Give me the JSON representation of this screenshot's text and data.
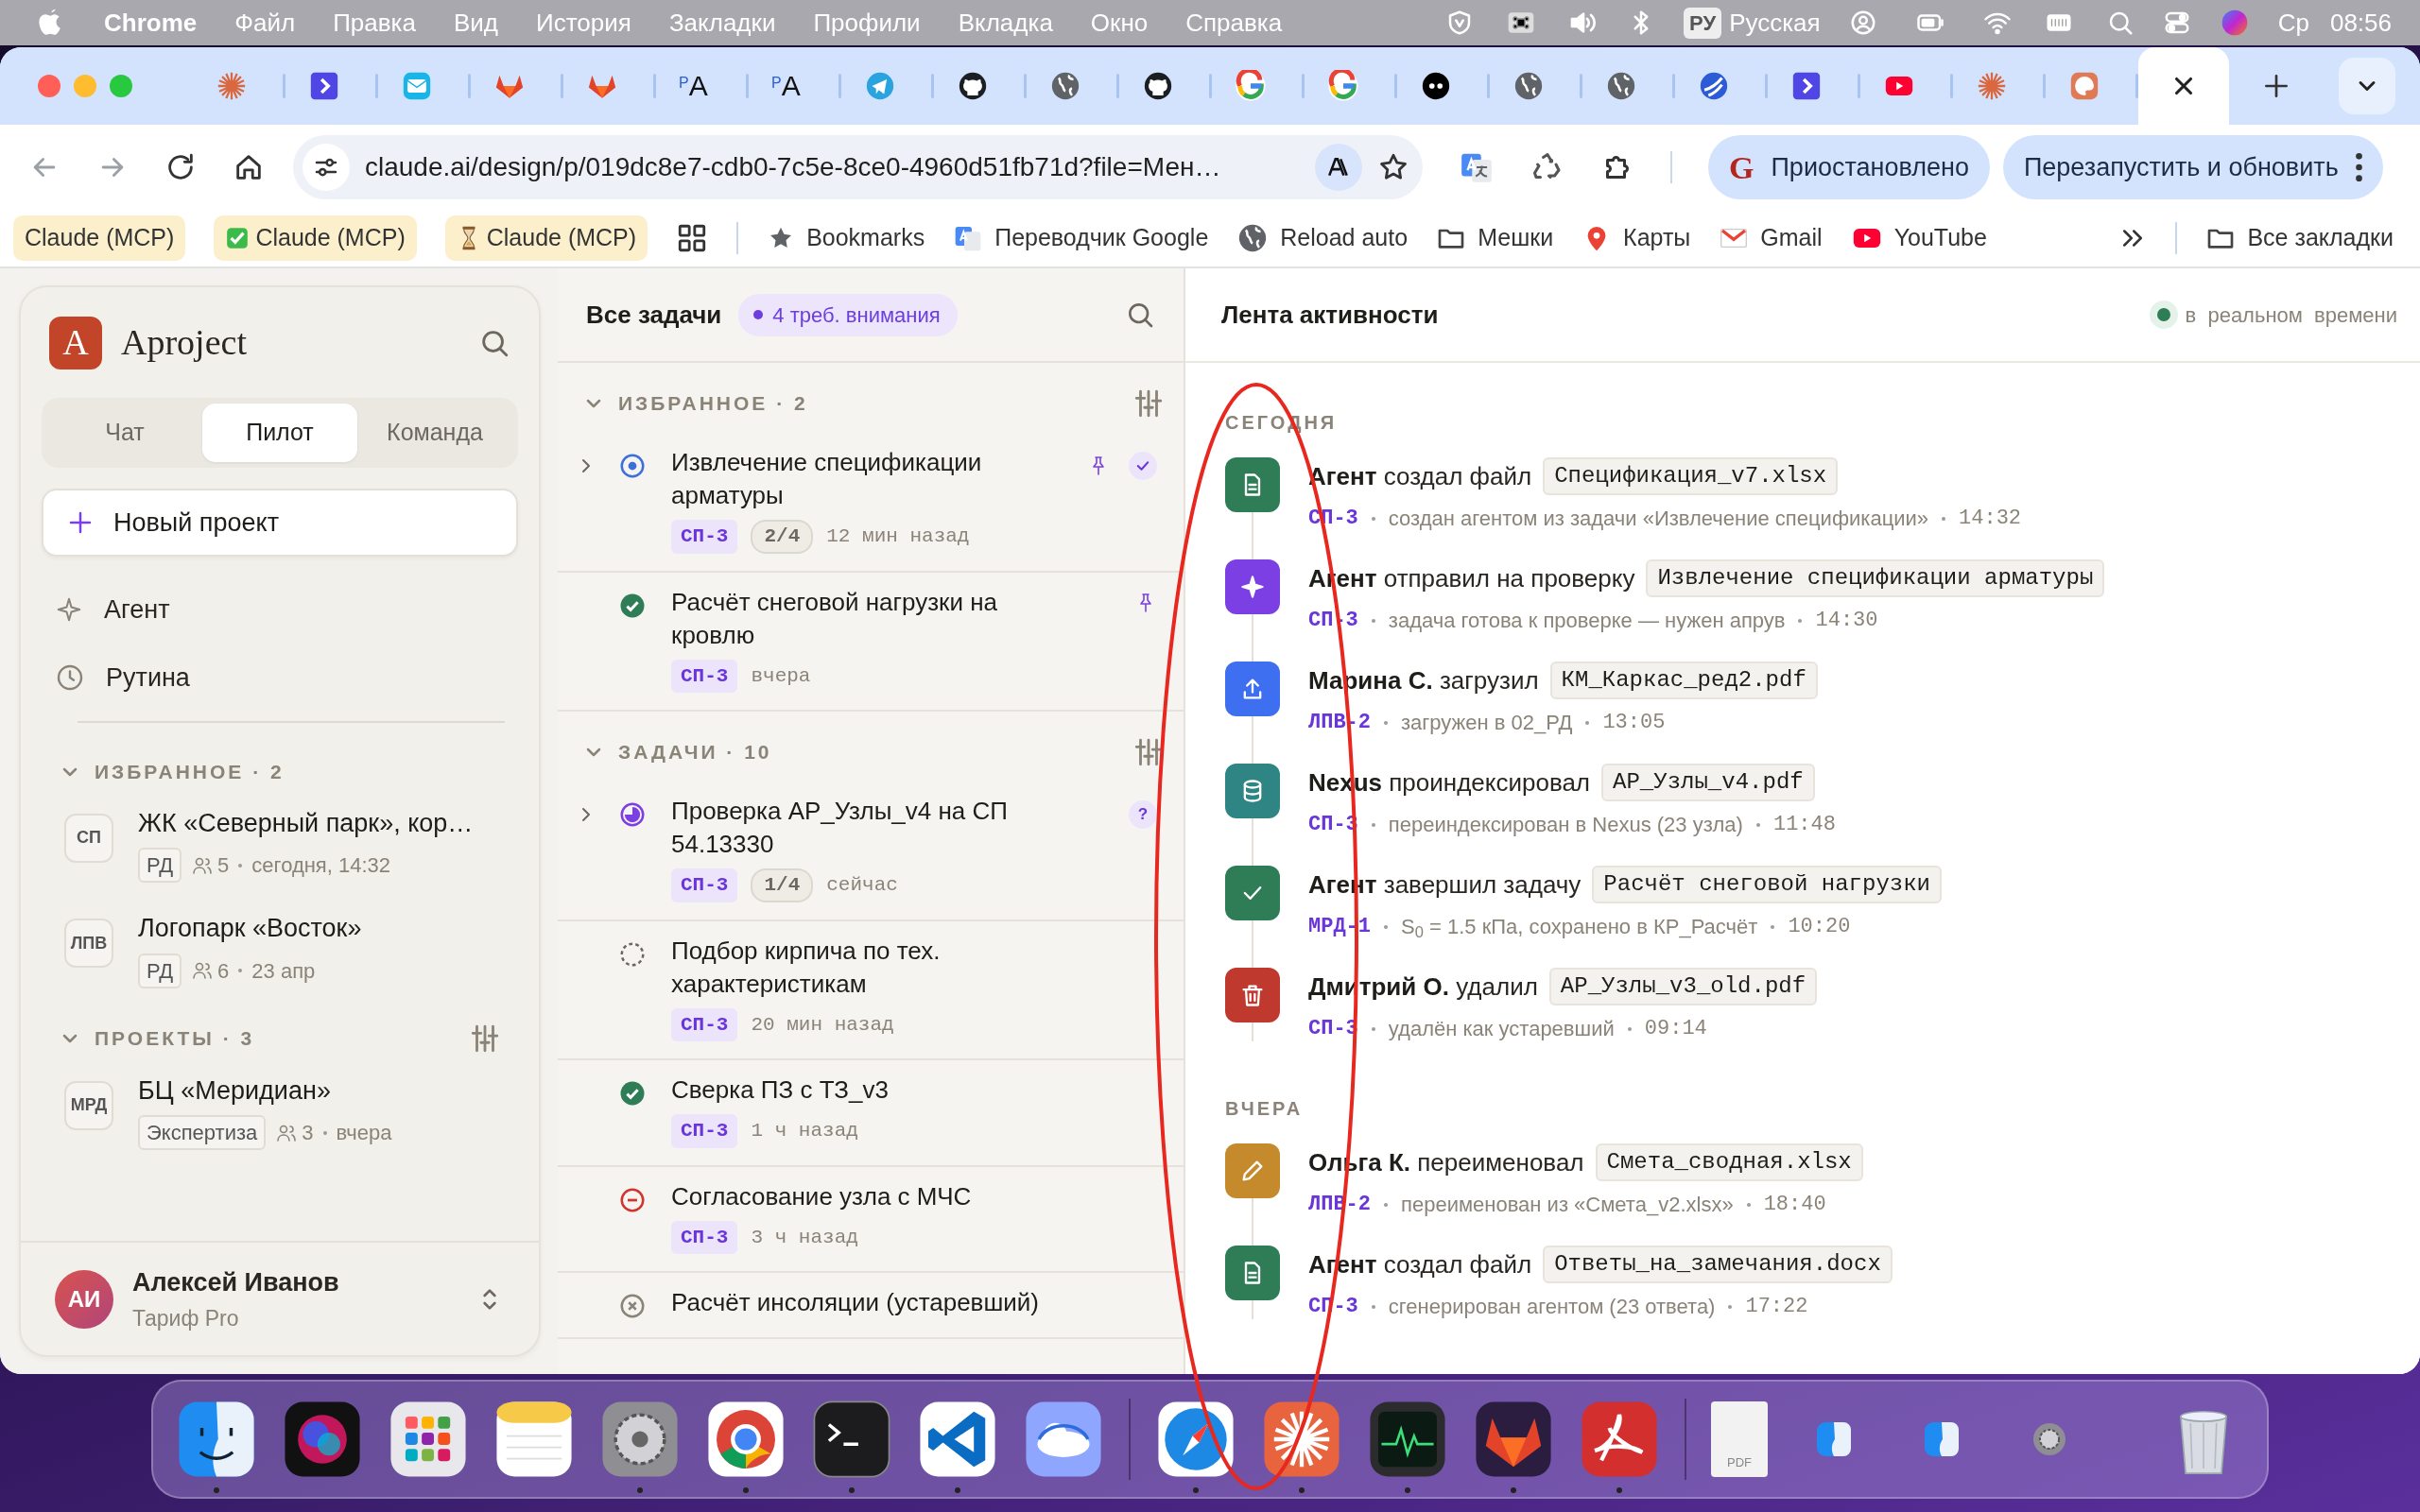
{
  "menu_bar": {
    "app": "Chrome",
    "menus": [
      "Файл",
      "Правка",
      "Вид",
      "История",
      "Закладки",
      "Профили",
      "Вкладка",
      "Окно",
      "Справка"
    ],
    "keyboard_badge": "РУ",
    "keyboard_layout": "Русская",
    "day": "Ср",
    "time": "08:56"
  },
  "browser": {
    "tabs": [
      {
        "kind": "sunburst",
        "selected": false
      },
      {
        "kind": "chevron-tile",
        "selected": false
      },
      {
        "kind": "mail-tile",
        "selected": false
      },
      {
        "kind": "fox",
        "selected": false
      },
      {
        "kind": "fox",
        "selected": false
      },
      {
        "kind": "letters",
        "text": "$^{P}$A",
        "selected": false
      },
      {
        "kind": "letters",
        "text": "$^{P}$A",
        "selected": false
      },
      {
        "kind": "plane",
        "selected": false
      },
      {
        "kind": "cat",
        "selected": false
      },
      {
        "kind": "globe",
        "selected": false
      },
      {
        "kind": "cat",
        "selected": false
      },
      {
        "kind": "ring",
        "selected": false
      },
      {
        "kind": "ring",
        "selected": false
      },
      {
        "kind": "dots",
        "selected": false
      },
      {
        "kind": "globe",
        "selected": false
      },
      {
        "kind": "globe",
        "selected": false
      },
      {
        "kind": "swirl",
        "selected": false
      },
      {
        "kind": "chevron-tile",
        "selected": false
      },
      {
        "kind": "video",
        "selected": false
      },
      {
        "kind": "sunburst",
        "selected": false
      },
      {
        "kind": "palette",
        "selected": false
      },
      {
        "kind": "blank",
        "selected": true
      }
    ],
    "address": "claude.ai/design/p/019dc8e7-cdb0-7c5e-8ce0-4960d51fb71d?file=Мен…",
    "profile": {
      "avatar": "G",
      "label": "Приостановлено"
    },
    "update_button": "Перезапустить и обновить",
    "bookmarks": [
      {
        "kind": "chip",
        "label": "Claude (MCP)"
      },
      {
        "kind": "chip-check",
        "label": "Claude (MCP)"
      },
      {
        "kind": "chip-hourglass",
        "label": "Claude (MCP)"
      },
      {
        "kind": "apps"
      },
      {
        "kind": "star",
        "label": "Bookmarks"
      },
      {
        "kind": "translate",
        "label": "Переводчик Google"
      },
      {
        "kind": "globe",
        "label": "Reload auto"
      },
      {
        "kind": "folder",
        "label": "Мешки"
      },
      {
        "kind": "pin",
        "label": "Карты"
      },
      {
        "kind": "mail",
        "label": "Gmail"
      },
      {
        "kind": "video",
        "label": "YouTube"
      }
    ],
    "all_bookmarks": "Все закладки"
  },
  "sidebar": {
    "logo": "A",
    "name": "Aproject",
    "tabs": [
      {
        "label": "Чат",
        "selected": false
      },
      {
        "label": "Пилот",
        "selected": true
      },
      {
        "label": "Команда",
        "selected": false
      }
    ],
    "new_project": "Новый проект",
    "nav": [
      {
        "kind": "agent",
        "label": "Агент"
      },
      {
        "kind": "routine",
        "label": "Рутина"
      }
    ],
    "sections": [
      {
        "title": "ИЗБРАННОЕ · 2",
        "expanded": true,
        "filter": false,
        "projects": [
          {
            "code": "СП",
            "name": "ЖК «Северный парк», кор…",
            "stage": "РД",
            "members": "5",
            "updated": "сегодня, 14:32"
          },
          {
            "code": "ЛПВ",
            "name": "Логопарк «Восток»",
            "stage": "РД",
            "members": "6",
            "updated": "23 апр"
          }
        ]
      },
      {
        "title": "ПРОЕКТЫ · 3",
        "expanded": true,
        "filter": true,
        "projects": [
          {
            "code": "МРД",
            "name": "БЦ «Меридиан»",
            "stage": "Экспертиза",
            "members": "3",
            "updated": "вчера"
          }
        ]
      }
    ],
    "user": {
      "initials": "АИ",
      "name": "Алексей Иванов",
      "plan": "Тариф Pro"
    }
  },
  "tasks_panel": {
    "title": "Все задачи",
    "attention": "4 треб. внимания",
    "groups": [
      {
        "title": "ИЗБРАННОЕ · 2",
        "expanded": true,
        "tasks": [
          {
            "kind": "in_progress",
            "expandable": true,
            "title": "Извлечение спецификации арматуры",
            "code": "СП-3",
            "progress": "2/4",
            "time": "12 мин назад",
            "pinned": true,
            "flag": {
              "kind": "check"
            }
          },
          {
            "kind": "done",
            "expandable": false,
            "title": "Расчёт снеговой нагрузки на кровлю",
            "code": "СП-3",
            "time": "вчера",
            "pinned": true
          }
        ]
      },
      {
        "title": "ЗАДАЧИ · 10",
        "expanded": true,
        "tasks": [
          {
            "kind": "review",
            "expandable": true,
            "title": "Проверка АР_Узлы_v4 на СП 54.13330",
            "code": "СП-3",
            "progress": "1/4",
            "time": "сейчас",
            "pinned": false,
            "flag": {
              "kind": "question",
              "text": "?"
            }
          },
          {
            "kind": "todo",
            "expandable": false,
            "title": "Подбор кирпича по тех. характеристикам",
            "code": "СП-3",
            "time": "20 мин назад",
            "pinned": false
          },
          {
            "kind": "done",
            "expandable": false,
            "title": "Сверка ПЗ с ТЗ_v3",
            "code": "СП-3",
            "time": "1 ч назад",
            "pinned": false
          },
          {
            "kind": "blocked",
            "expandable": false,
            "title": "Согласование узла с МЧС",
            "code": "СП-3",
            "time": "3 ч назад",
            "pinned": false
          },
          {
            "kind": "cancelled",
            "expandable": false,
            "title": "Расчёт инсоляции (устаревший)",
            "pinned": false
          }
        ]
      }
    ]
  },
  "feed": {
    "title": "Лента активности",
    "live": {
      "on": true,
      "label": "в реальном времени"
    },
    "days": [
      {
        "label": "СЕГОДНЯ",
        "events": [
          {
            "kind": "file",
            "color": "#2f7d57",
            "actor": "Агент",
            "action": "создал файл",
            "object": "Спецификация_v7.xlsx",
            "code": "СП-3",
            "detail": "создан агентом из задачи «Извлечение спецификации»",
            "time": "14:32"
          },
          {
            "kind": "review",
            "color": "#7b3fe4",
            "actor": "Агент",
            "action": "отправил на проверку",
            "object": "Извлечение спецификации арматуры",
            "code": "СП-3",
            "detail": "задача готова к проверке — нужен апрув",
            "time": "14:30"
          },
          {
            "kind": "upload",
            "color": "#3d6ff0",
            "actor": "Марина С.",
            "action": "загрузил",
            "object": "КМ_Каркас_ред2.pdf",
            "code": "ЛПВ-2",
            "detail": "загружен в 02_РД",
            "time": "13:05"
          },
          {
            "kind": "index",
            "color": "#2e8584",
            "actor": "Nexus",
            "action": "проиндексировал",
            "object": "АР_Узлы_v4.pdf",
            "code": "СП-3",
            "detail": "переиндексирован в Nexus (23 узла)",
            "time": "11:48"
          },
          {
            "kind": "done",
            "color": "#2f7d57",
            "actor": "Агент",
            "action": "завершил задачу",
            "object": "Расчёт снеговой нагрузки",
            "code": "МРД-1",
            "detail": "S$_{0}$ = 1.5 кПа, сохранено в КР_Расчёт",
            "time": "10:20"
          },
          {
            "kind": "delete",
            "color": "#c0392f",
            "actor": "Дмитрий О.",
            "action": "удалил",
            "object": "АР_Узлы_v3_old.pdf",
            "code": "СП-3",
            "detail": "удалён как устаревший",
            "time": "09:14"
          }
        ]
      },
      {
        "label": "ВЧЕРА",
        "events": [
          {
            "kind": "rename",
            "color": "#c48a2c",
            "actor": "Ольга К.",
            "action": "переименовал",
            "object": "Смета_сводная.xlsx",
            "code": "ЛПВ-2",
            "detail": "переименован из «Смета_v2.xlsx»",
            "time": "18:40"
          },
          {
            "kind": "file",
            "color": "#2f7d57",
            "actor": "Агент",
            "action": "создал файл",
            "object": "Ответы_на_замечания.docx",
            "code": "СП-3",
            "detail": "сгенерирован агентом (23 ответа)",
            "time": "17:22"
          }
        ]
      }
    ]
  },
  "dock": [
    {
      "kind": "face",
      "running": true
    },
    {
      "kind": "orb",
      "running": false
    },
    {
      "kind": "grid",
      "running": false
    },
    {
      "kind": "notepad",
      "running": false
    },
    {
      "kind": "gear",
      "running": true
    },
    {
      "kind": "wheel",
      "running": true
    },
    {
      "kind": "terminal",
      "running": true
    },
    {
      "kind": "ribbon",
      "running": true
    },
    {
      "kind": "cloud",
      "running": false
    },
    {
      "kind": "separator"
    },
    {
      "kind": "compass",
      "running": true
    },
    {
      "kind": "sunburst",
      "running": true
    },
    {
      "kind": "monitor",
      "running": true
    },
    {
      "kind": "fox",
      "running": true
    },
    {
      "kind": "swirl",
      "running": true
    },
    {
      "kind": "separator"
    },
    {
      "kind": "document",
      "label": "PDF"
    },
    {
      "kind": "mini-face"
    },
    {
      "kind": "mini-face"
    },
    {
      "kind": "mini-gear"
    },
    {
      "kind": "trash"
    }
  ]
}
